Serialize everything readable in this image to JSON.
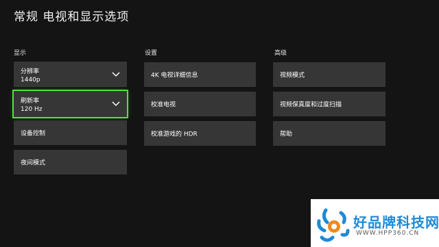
{
  "page": {
    "title": "常规 电视和显示选项"
  },
  "sections": {
    "display": {
      "header": "显示",
      "resolution": {
        "label": "分辨率",
        "value": "1440p"
      },
      "refresh_rate": {
        "label": "刷新率",
        "value": "120 Hz"
      },
      "device_control": "设备控制",
      "night_mode": "夜间模式"
    },
    "setup": {
      "header": "设置",
      "items": [
        "4K 电视详细信息",
        "校准电视",
        "校准游戏的 HDR"
      ]
    },
    "advanced": {
      "header": "高级",
      "items": [
        "视频模式",
        "视频保真度和过度扫描",
        "帮助"
      ]
    }
  },
  "watermark": {
    "title": "好品牌科技网",
    "url": "WWW.HPP360.CN"
  },
  "colors": {
    "background": "#141414",
    "tile": "#363636",
    "focus": "#4ce636",
    "watermark_blue": "#1e8ad6"
  },
  "icons": {
    "dropdown": "chevron-down-icon",
    "logo": "sun-logo-icon"
  }
}
